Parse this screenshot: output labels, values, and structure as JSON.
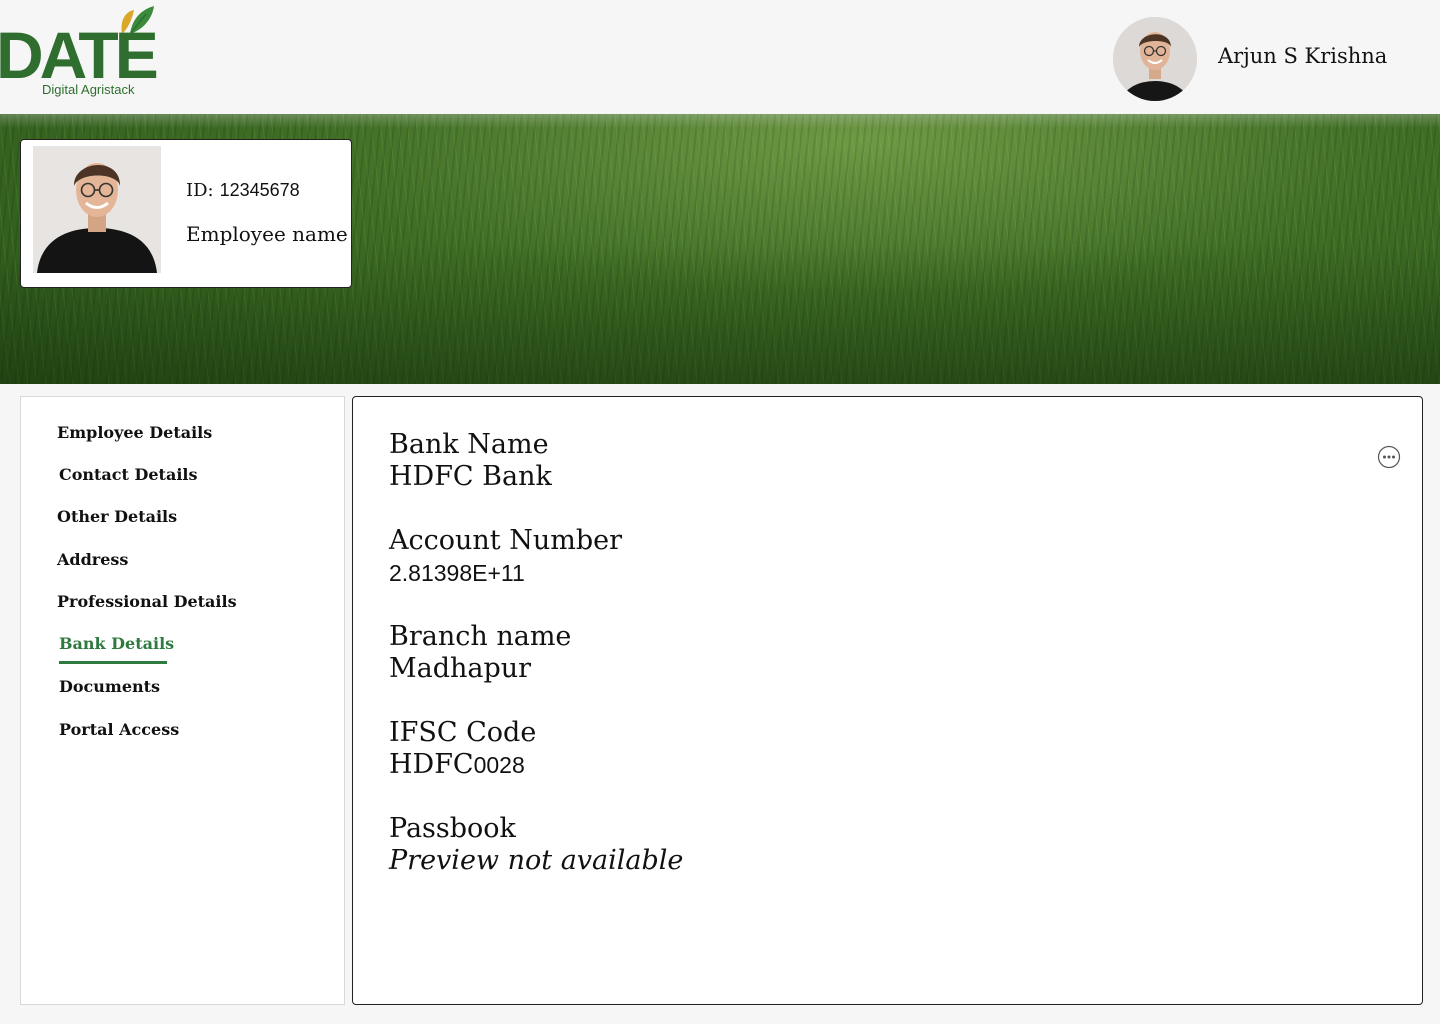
{
  "brand": {
    "logo_text": "DATE",
    "logo_subtitle": "Digital Agristack",
    "primary_color": "#2f6e2f",
    "leaf_colors": [
      "#d9a72a",
      "#3c8a3c"
    ]
  },
  "user": {
    "name": "Arjun S Krishna",
    "avatar_icon": "user-avatar"
  },
  "profile_card": {
    "id_label": "ID:",
    "id_value": "12345678",
    "name_label": "Employee name"
  },
  "sidebar": {
    "active_color": "#2e7a3f",
    "items": [
      {
        "label": "Employee Details",
        "active": false
      },
      {
        "label": "Contact Details",
        "active": false
      },
      {
        "label": "Other Details",
        "active": false
      },
      {
        "label": "Address",
        "active": false
      },
      {
        "label": "Professional Details",
        "active": false
      },
      {
        "label": "Bank Details",
        "active": true
      },
      {
        "label": "Documents",
        "active": false
      },
      {
        "label": "Portal Access",
        "active": false
      }
    ]
  },
  "bank_details": {
    "bank_name": {
      "label": "Bank Name",
      "value": "HDFC Bank"
    },
    "account_number": {
      "label": "Account Number",
      "value": "2.81398E+11"
    },
    "branch_name": {
      "label": "Branch name",
      "value": "Madhapur"
    },
    "ifsc_code": {
      "label": "IFSC Code",
      "value_prefix": "HDFC",
      "value_suffix": "0028"
    },
    "passbook": {
      "label": "Passbook",
      "value": "Preview not available"
    }
  },
  "actions": {
    "more_icon": "more-options-icon"
  }
}
